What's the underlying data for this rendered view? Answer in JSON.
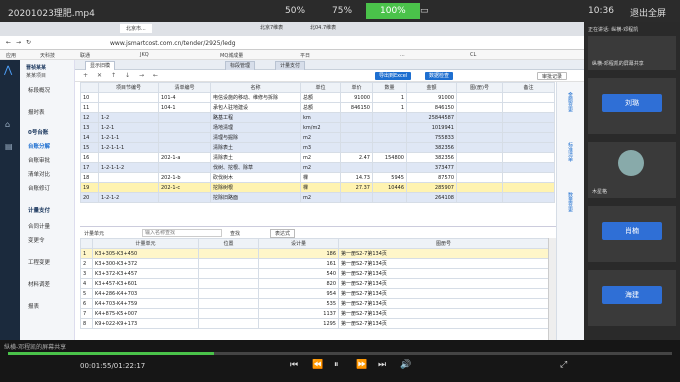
{
  "player": {
    "filename": "20201023理肥.mp4",
    "speed_options": [
      "50%",
      "75%",
      "100%"
    ],
    "time_of_day": "10:36",
    "exit_fullscreen": "退出全屏",
    "timeline": "00:01:55/01:22:17",
    "progress_fraction": 0.31
  },
  "browser": {
    "url": "www.jsmartcost.com.cn/tender/2925/ledg",
    "tabs": [
      "北京市...",
      "北京7维表",
      "北04.7维表"
    ],
    "bookmarks": [
      "应用",
      "天科技",
      "联通",
      "JKQ",
      "MQ城成量",
      "平日",
      "...",
      "CL"
    ]
  },
  "app": {
    "title": "晋祯某某",
    "subtitle": "某某项目",
    "nav": [
      {
        "label": "标段概况",
        "type": "item"
      },
      {
        "label": "报时表",
        "type": "item"
      },
      {
        "label": "0号台账",
        "type": "section"
      },
      {
        "label": "台账分解",
        "type": "active"
      },
      {
        "label": "台账审批",
        "type": "item"
      },
      {
        "label": "清单对比",
        "type": "item"
      },
      {
        "label": "台账修订",
        "type": "item"
      },
      {
        "label": "计量支付",
        "type": "section"
      },
      {
        "label": "合同计量",
        "type": "item"
      },
      {
        "label": "变更令",
        "type": "item"
      },
      {
        "label": "工程变更",
        "type": "item"
      },
      {
        "label": "材料调差",
        "type": "item"
      },
      {
        "label": "报表",
        "type": "item"
      }
    ],
    "tabs": [
      "显示旧模",
      "标段管理",
      "计量支付"
    ],
    "toolbar": [
      "导出到Excel",
      "数据检查",
      "审批记录"
    ],
    "grid1": {
      "headers": [
        "",
        "项目节编号",
        "清单编号",
        "名称",
        "单位",
        "单价",
        "数量",
        "金额",
        "图(册)号",
        "备注"
      ],
      "rows": [
        {
          "n": "10",
          "code": "",
          "bill": "101-4",
          "name": "电信设施的移动、维修与拆除",
          "unit": "总额",
          "price": "91000",
          "qty": "1",
          "amt": "91000",
          "cls": ""
        },
        {
          "n": "11",
          "code": "",
          "bill": "104-1",
          "name": "承包人驻地建设",
          "unit": "总额",
          "price": "846150",
          "qty": "1",
          "amt": "846150",
          "cls": ""
        },
        {
          "n": "12",
          "code": "1-2",
          "bill": "",
          "name": "路基工程",
          "unit": "km",
          "price": "",
          "qty": "",
          "amt": "25844587",
          "cls": "hl"
        },
        {
          "n": "13",
          "code": "1-2-1",
          "bill": "",
          "name": "场地清理",
          "unit": "km/m2",
          "price": "",
          "qty": "",
          "amt": "1019941",
          "cls": "hl"
        },
        {
          "n": "14",
          "code": "1-2-1-1",
          "bill": "",
          "name": "清理与掘除",
          "unit": "m2",
          "price": "",
          "qty": "",
          "amt": "755833",
          "cls": "hl"
        },
        {
          "n": "15",
          "code": "1-2-1-1-1",
          "bill": "",
          "name": "清除表土",
          "unit": "m3",
          "price": "",
          "qty": "",
          "amt": "382356",
          "cls": "hl"
        },
        {
          "n": "16",
          "code": "",
          "bill": "202-1-a",
          "name": "清除表土",
          "unit": "m2",
          "price": "2.47",
          "qty": "154800",
          "amt": "382356",
          "cls": ""
        },
        {
          "n": "17",
          "code": "1-2-1-1-2",
          "bill": "",
          "name": "伐树、挖根、除草",
          "unit": "m2",
          "price": "",
          "qty": "",
          "amt": "373477",
          "cls": "hl"
        },
        {
          "n": "18",
          "code": "",
          "bill": "202-1-b",
          "name": "砍伐树木",
          "unit": "棵",
          "price": "14.73",
          "qty": "5945",
          "amt": "87570",
          "cls": ""
        },
        {
          "n": "19",
          "code": "",
          "bill": "202-1-c",
          "name": "挖除树根",
          "unit": "棵",
          "price": "27.37",
          "qty": "10446",
          "amt": "285907",
          "cls": "seltop"
        },
        {
          "n": "20",
          "code": "1-2-1-2",
          "bill": "",
          "name": "挖除旧路面",
          "unit": "m2",
          "price": "",
          "qty": "",
          "amt": "264108",
          "cls": "hl"
        }
      ]
    },
    "grid2": {
      "toolbar_label": "计量单元",
      "placeholder": "输入名称查找",
      "find_label": "查找",
      "expr_label": "表达式",
      "headers": [
        "",
        "计量单元",
        "位置",
        "设计量",
        "图册号"
      ],
      "rows": [
        {
          "n": "1",
          "unit": "K3+305-K3+450",
          "pos": "",
          "qty": "186",
          "book": "第一册S2-7第134页",
          "cls": "sel"
        },
        {
          "n": "2",
          "unit": "K3+300-K3+372",
          "pos": "",
          "qty": "161",
          "book": "第一册S2-7第134页",
          "cls": ""
        },
        {
          "n": "3",
          "unit": "K3+372-K3+457",
          "pos": "",
          "qty": "540",
          "book": "第一册S2-7第134页",
          "cls": ""
        },
        {
          "n": "4",
          "unit": "K3+457-K3+601",
          "pos": "",
          "qty": "820",
          "book": "第一册S2-7第134页",
          "cls": ""
        },
        {
          "n": "5",
          "unit": "K4+286-K4+703",
          "pos": "",
          "qty": "954",
          "book": "第一册S2-7第134页",
          "cls": ""
        },
        {
          "n": "6",
          "unit": "K4+703-K4+759",
          "pos": "",
          "qty": "535",
          "book": "第一册S2-7第134页",
          "cls": ""
        },
        {
          "n": "7",
          "unit": "K4+875-K5+007",
          "pos": "",
          "qty": "1137",
          "book": "第一册S2-7第134页",
          "cls": ""
        },
        {
          "n": "8",
          "unit": "K9+022-K9+173",
          "pos": "",
          "qty": "1295",
          "book": "第一册S2-7第134页",
          "cls": ""
        }
      ]
    },
    "right_strip": [
      "金额变更",
      "标准清单",
      "数量变更"
    ]
  },
  "meeting": {
    "speaker": "正在讲话: 纵横-邓程凯",
    "participants": [
      "纵横-邓程凯的屏幕共享",
      "刘璐",
      "木星格",
      "肖楠",
      "海建"
    ],
    "share_caption": "纵横-邓程凯的屏幕共享"
  }
}
